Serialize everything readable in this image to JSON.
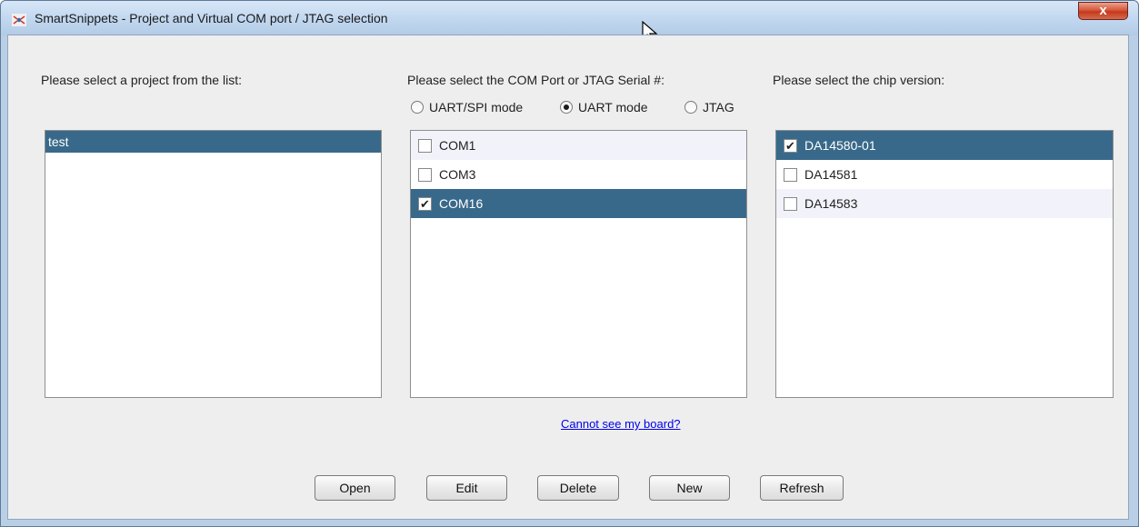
{
  "window": {
    "title": "SmartSnippets - Project and Virtual COM port / JTAG selection",
    "close_label": "x"
  },
  "projects": {
    "heading": "Please select a project from the list:",
    "items": [
      "test"
    ],
    "selected_index": 0
  },
  "ports": {
    "heading": "Please select the COM Port or JTAG Serial #:",
    "modes": [
      {
        "label": "UART/SPI mode",
        "selected": false
      },
      {
        "label": "UART mode",
        "selected": true
      },
      {
        "label": "JTAG",
        "selected": false
      }
    ],
    "items": [
      {
        "label": "COM1",
        "checked": false
      },
      {
        "label": "COM3",
        "checked": false
      },
      {
        "label": "COM16",
        "checked": true
      }
    ]
  },
  "chips": {
    "heading": "Please select the chip version:",
    "items": [
      {
        "label": "DA14580-01",
        "checked": true
      },
      {
        "label": "DA14581",
        "checked": false
      },
      {
        "label": "DA14583",
        "checked": false
      }
    ]
  },
  "help_link": "Cannot see my board?",
  "buttons": {
    "open": "Open",
    "edit": "Edit",
    "delete": "Delete",
    "new": "New",
    "refresh": "Refresh"
  },
  "colors": {
    "selection": "#39698a",
    "link": "#0000ee"
  }
}
